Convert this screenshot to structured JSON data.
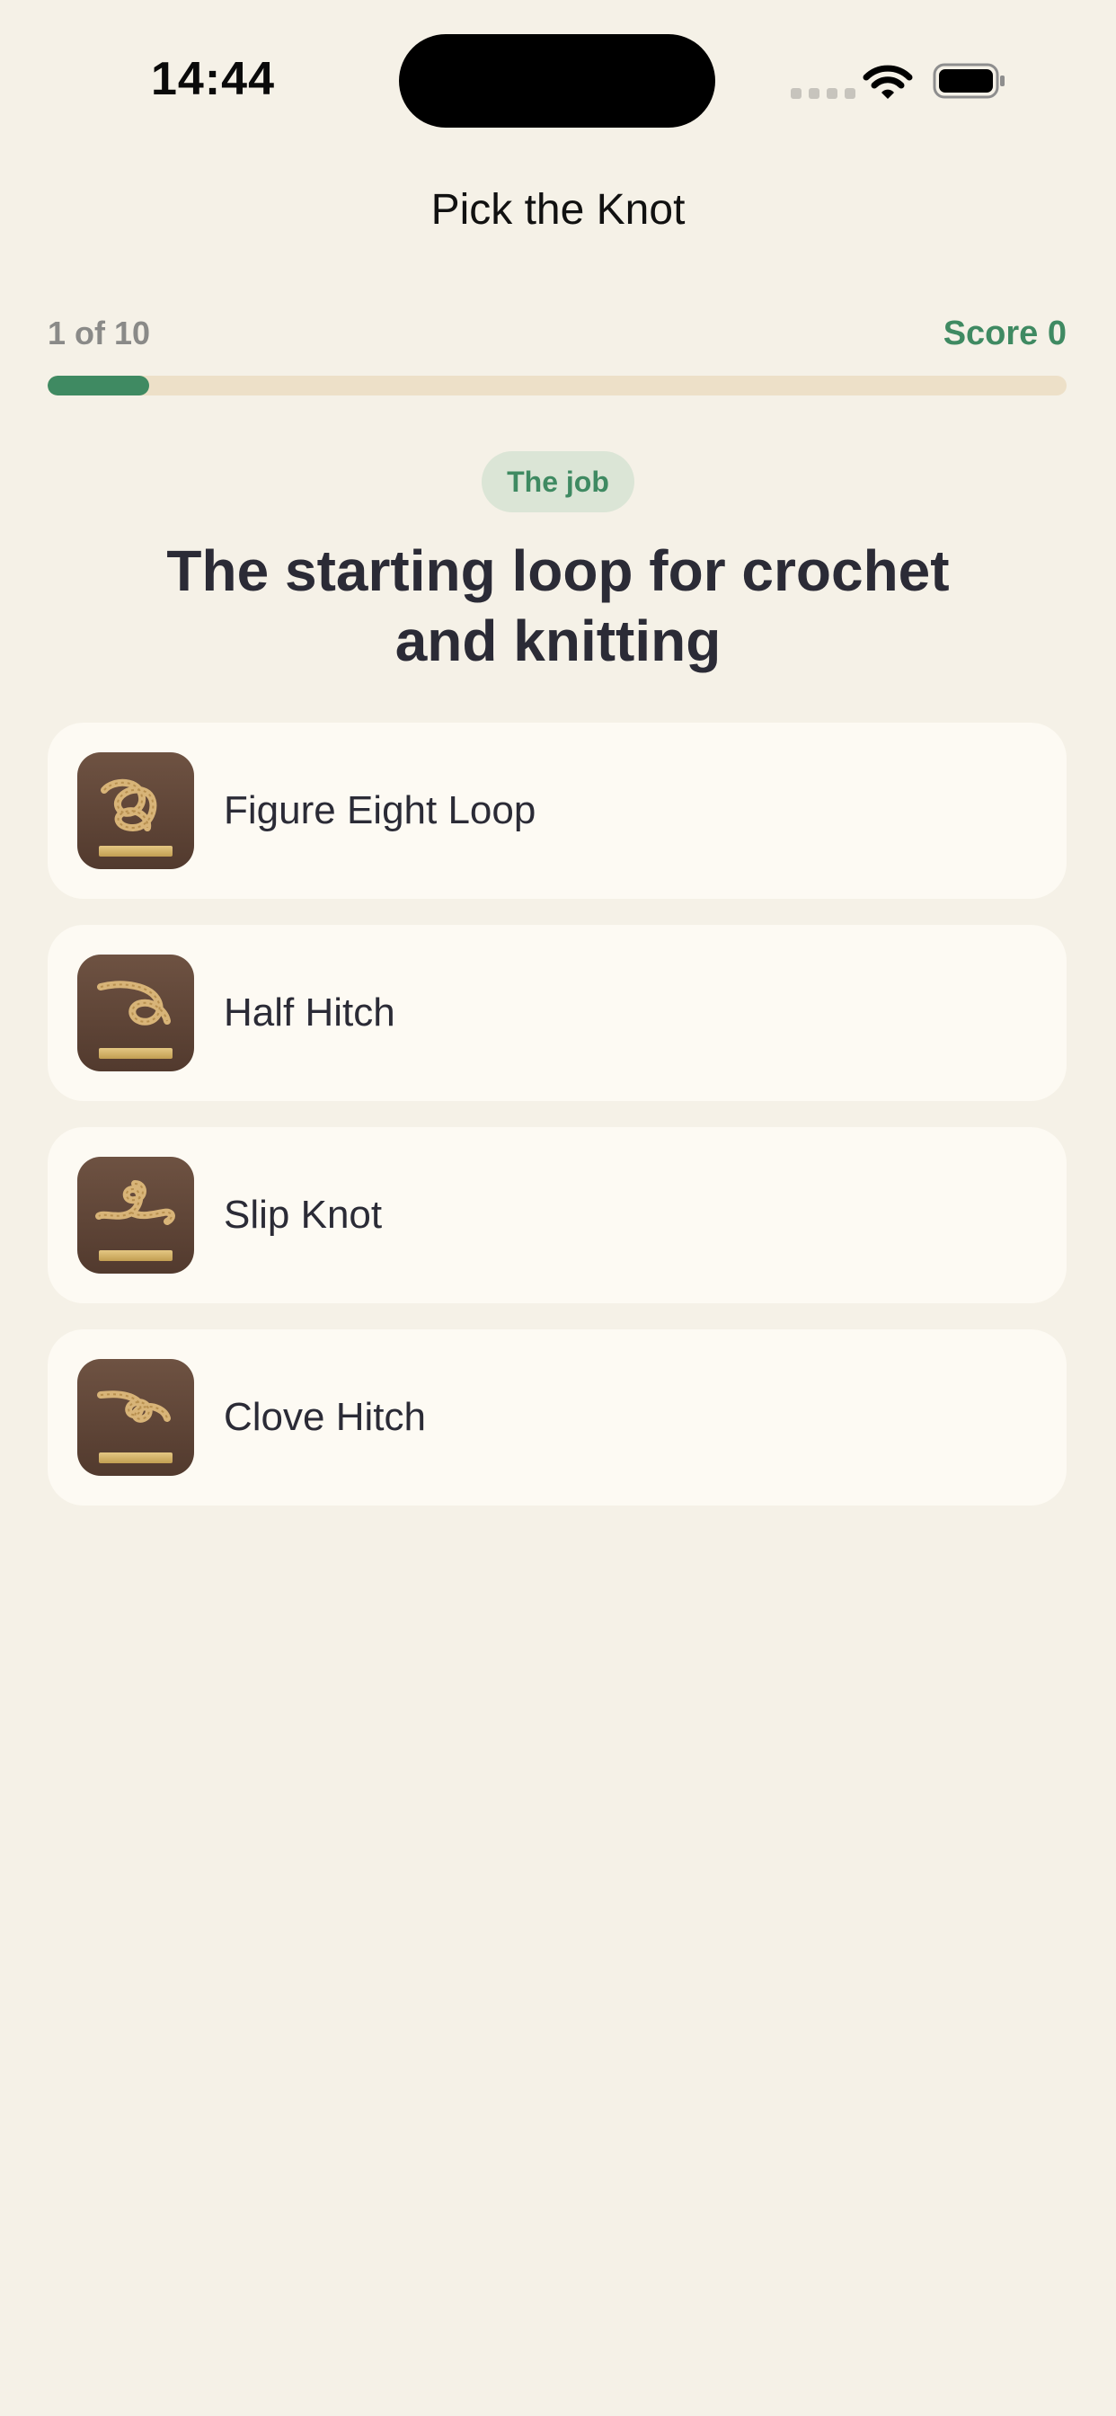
{
  "status_bar": {
    "time": "14:44"
  },
  "nav": {
    "title": "Pick the Knot"
  },
  "progress": {
    "count_text": "1 of 10",
    "score_text": "Score 0",
    "fraction": 0.1
  },
  "badge": {
    "label": "The job"
  },
  "question": {
    "text": "The starting loop for crochet and knitting"
  },
  "options": [
    {
      "label": "Figure Eight Loop",
      "icon": "figure-eight-loop-icon"
    },
    {
      "label": "Half Hitch",
      "icon": "half-hitch-icon"
    },
    {
      "label": "Slip Knot",
      "icon": "slip-knot-icon"
    },
    {
      "label": "Clove Hitch",
      "icon": "clove-hitch-icon"
    }
  ],
  "colors": {
    "background": "#f5f1e7",
    "accent": "#3f8a62",
    "card": "#fdfaf3",
    "track": "#ede0c8"
  }
}
